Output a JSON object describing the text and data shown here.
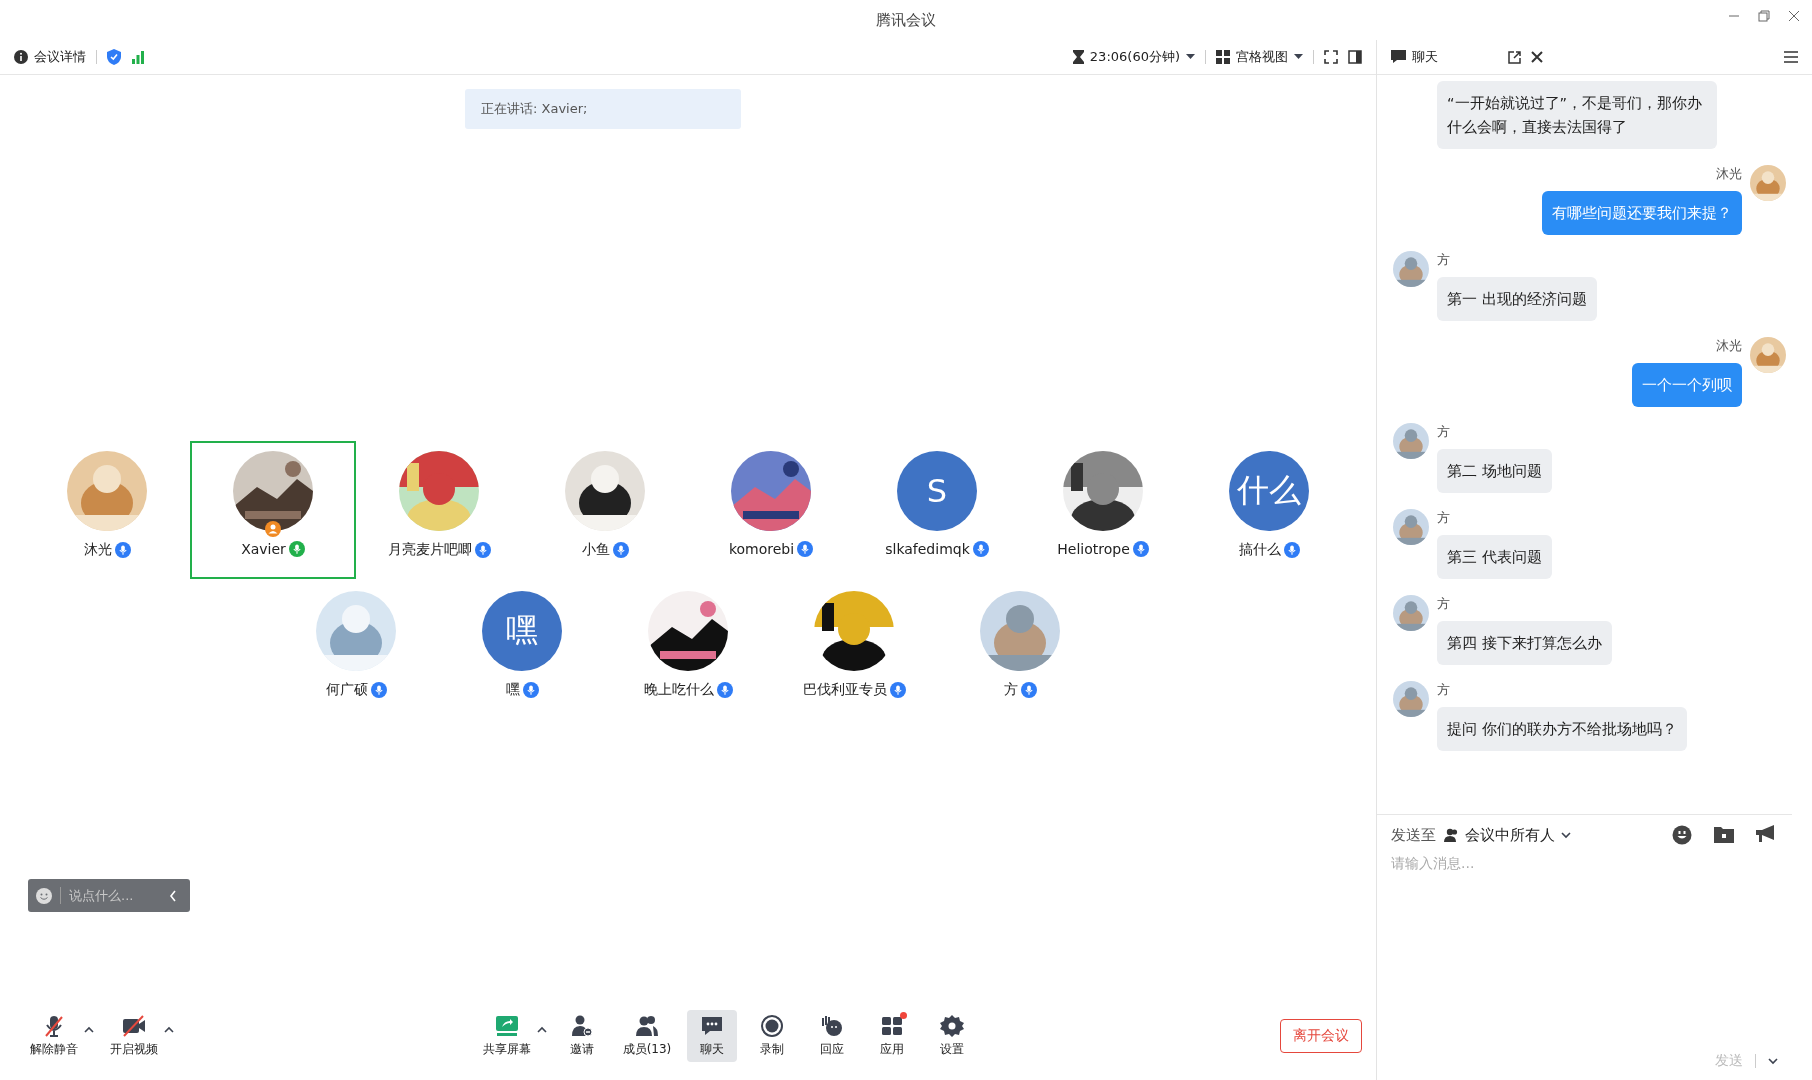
{
  "window": {
    "title": "腾讯会议"
  },
  "toolbar": {
    "meeting_info": "会议详情",
    "timer": "23:06(60分钟)",
    "view": "宫格视图"
  },
  "speaking_banner": "正在讲话: Xavier;",
  "participants": [
    {
      "name": "沐光",
      "speaking": false,
      "host": false
    },
    {
      "name": "Xavier",
      "speaking": true,
      "host": true
    },
    {
      "name": "月亮麦片吧唧",
      "speaking": false,
      "host": false
    },
    {
      "name": "小鱼",
      "speaking": false,
      "host": false
    },
    {
      "name": "komorebi",
      "speaking": false,
      "host": false
    },
    {
      "name": "slkafedimqk",
      "avatar": {
        "kind": "letter",
        "text": "S"
      },
      "speaking": false,
      "host": false
    },
    {
      "name": "Heliotrope",
      "speaking": false,
      "host": false
    },
    {
      "name": "搞什么",
      "avatar": {
        "kind": "letter",
        "text": "什么"
      },
      "speaking": false,
      "host": false
    },
    {
      "name": "何广硕",
      "speaking": false,
      "host": false
    },
    {
      "name": "嘿",
      "avatar": {
        "kind": "letter",
        "text": "嘿"
      },
      "speaking": false,
      "host": false
    },
    {
      "name": "晚上吃什么",
      "speaking": false,
      "host": false
    },
    {
      "name": "巴伐利亚专员",
      "speaking": false,
      "host": false
    },
    {
      "name": "方",
      "speaking": false,
      "host": false
    }
  ],
  "quick_chat": {
    "placeholder": "说点什么..."
  },
  "controls": [
    {
      "label": "解除静音",
      "caret": true
    },
    {
      "label": "开启视频",
      "caret": true
    }
  ],
  "actions": [
    {
      "label": "共享屏幕",
      "caret": true,
      "selected": false,
      "badge": false
    },
    {
      "label": "邀请",
      "caret": false,
      "selected": false,
      "badge": false
    },
    {
      "label": "成员(13)",
      "caret": false,
      "selected": false,
      "badge": false
    },
    {
      "label": "聊天",
      "caret": false,
      "selected": true,
      "badge": false
    },
    {
      "label": "录制",
      "caret": false,
      "selected": false,
      "badge": false
    },
    {
      "label": "回应",
      "caret": false,
      "selected": false,
      "badge": false
    },
    {
      "label": "应用",
      "caret": false,
      "selected": false,
      "badge": true
    },
    {
      "label": "设置",
      "caret": false,
      "selected": false,
      "badge": false
    }
  ],
  "leave_button": "离开会议",
  "chat": {
    "title": "聊天",
    "messages": [
      {
        "kind": "in",
        "text": "“一开始就说过了”，不是哥们，那你办什么会啊，直接去法国得了"
      },
      {
        "kind": "out",
        "sender": "沐光",
        "text": "有哪些问题还要我们来提？"
      },
      {
        "kind": "in",
        "sender": "方",
        "text": "第一 出现的经济问题"
      },
      {
        "kind": "out",
        "sender": "沐光",
        "text": "一个一个列呗"
      },
      {
        "kind": "in",
        "sender": "方",
        "text": "第二 场地问题"
      },
      {
        "kind": "in",
        "sender": "方",
        "text": "第三 代表问题"
      },
      {
        "kind": "in",
        "sender": "方",
        "text": "第四 接下来打算怎么办"
      },
      {
        "kind": "in",
        "sender": "方",
        "text": "提问 你们的联办方不给批场地吗？"
      }
    ],
    "send_to_label": "发送至",
    "recipient": "会议中所有人",
    "placeholder": "请输入消息...",
    "send_button": "发送"
  }
}
